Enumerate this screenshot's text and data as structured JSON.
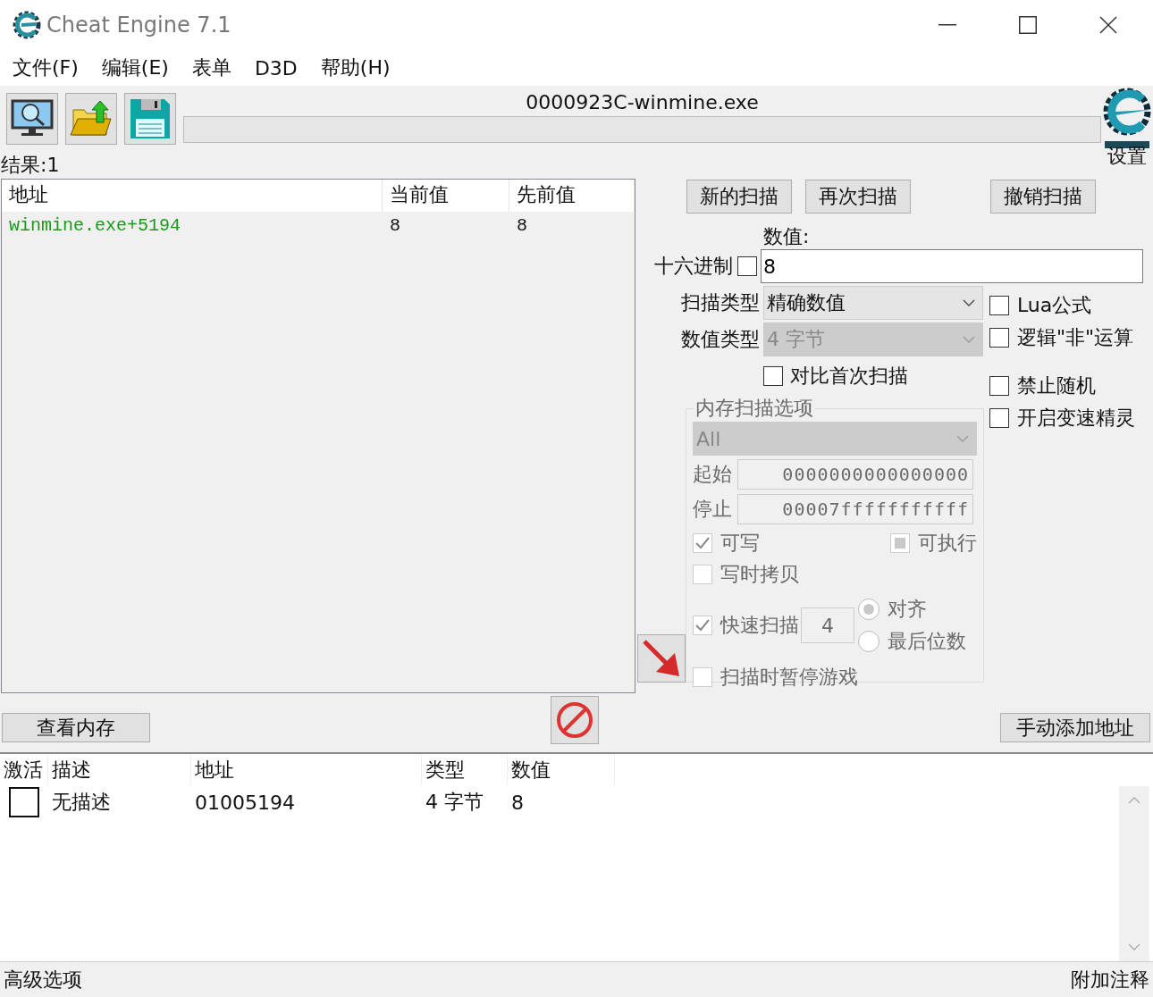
{
  "window": {
    "title": "Cheat Engine 7.1"
  },
  "menu": [
    "文件(F)",
    "编辑(E)",
    "表单",
    "D3D",
    "帮助(H)"
  ],
  "toolbar": {
    "process": "0000923C-winmine.exe",
    "level": 0,
    "settings": "设置"
  },
  "results": {
    "label": "结果:1",
    "columns": [
      "地址",
      "当前值",
      "先前值"
    ],
    "rows": [
      {
        "cells": [
          "winmine.exe+5194",
          "8",
          "8"
        ]
      }
    ]
  },
  "scan_buttons": [
    "新的扫描",
    "再次扫描",
    "撤销扫描"
  ],
  "value": {
    "label": "数值:",
    "value": "8"
  },
  "hex": {
    "label": "十六进制",
    "checked": false
  },
  "scan_type": {
    "label": "扫描类型",
    "value": "精确数值",
    "disabled": false
  },
  "value_type": {
    "label": "数值类型",
    "value": "4 字节",
    "disabled": true
  },
  "compare_first": {
    "label": "对比首次扫描",
    "checked": false
  },
  "options": [
    {
      "label": "Lua公式",
      "checked": false
    },
    {
      "label": "逻辑\"非\"运算",
      "checked": false
    },
    {
      "label": "禁止随机",
      "checked": false
    },
    {
      "label": "开启变速精灵",
      "checked": false
    }
  ],
  "memory_options": {
    "title": "内存扫描选项",
    "disabled": true,
    "region": "All",
    "start": {
      "label": "起始",
      "value": "0000000000000000"
    },
    "stop": {
      "label": "停止",
      "value": "00007fffffffffff"
    },
    "writable": {
      "label": "可写",
      "checked": true
    },
    "executable": {
      "label": "可执行",
      "mixed": true
    },
    "copy_on_write": {
      "label": "写时拷贝",
      "checked": false
    },
    "fast_scan": {
      "label": "快速扫描",
      "checked": true,
      "value": "4"
    },
    "alignment": [
      {
        "label": "对齐",
        "selected": true
      },
      {
        "label": "最后位数",
        "selected": false
      }
    ],
    "pause_game": {
      "label": "扫描时暂停游戏",
      "checked": false
    }
  },
  "view_memory": "查看内存",
  "add_address": "手动添加地址",
  "address_list": {
    "active_header": "激活",
    "columns": [
      "描述",
      "地址",
      "类型",
      "数值"
    ],
    "rows": [
      {
        "active": false,
        "cells": [
          "无描述",
          "01005194",
          "4 字节",
          "8"
        ]
      }
    ]
  },
  "footer": {
    "left": "高级选项",
    "right": "附加注释"
  }
}
